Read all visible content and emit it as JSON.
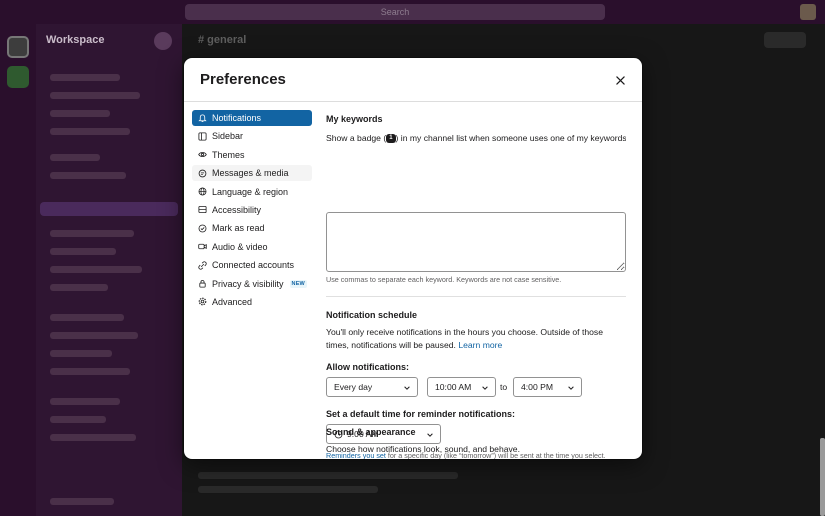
{
  "background": {
    "search_placeholder": "Search",
    "workspace_name": "Workspace",
    "channel_title": "# general"
  },
  "modal": {
    "title": "Preferences",
    "close_icon": "close-icon"
  },
  "nav": [
    {
      "label": "Notifications",
      "icon": "bell-icon",
      "active": true
    },
    {
      "label": "Sidebar",
      "icon": "sidebar-icon"
    },
    {
      "label": "Themes",
      "icon": "eye-icon"
    },
    {
      "label": "Messages & media",
      "icon": "message-icon",
      "hover": true
    },
    {
      "label": "Language & region",
      "icon": "globe-icon"
    },
    {
      "label": "Accessibility",
      "icon": "accessibility-icon"
    },
    {
      "label": "Mark as read",
      "icon": "check-circle-icon"
    },
    {
      "label": "Audio & video",
      "icon": "video-icon"
    },
    {
      "label": "Connected accounts",
      "icon": "link-icon"
    },
    {
      "label": "Privacy & visibility",
      "icon": "lock-icon",
      "badge": "NEW"
    },
    {
      "label": "Advanced",
      "icon": "gear-icon"
    }
  ],
  "keywords": {
    "heading": "My keywords",
    "desc_before": "Show a badge (",
    "badge_count": "1",
    "desc_after": ") in my channel list when someone uses one of my keywords:",
    "value": "",
    "help": "Use commas to separate each keyword. Keywords are not case sensitive."
  },
  "schedule": {
    "heading": "Notification schedule",
    "desc": "You'll only receive notifications in the hours you choose. Outside of those times, notifications will be paused.",
    "learn_more": "Learn more",
    "allow_label": "Allow notifications:",
    "day_value": "Every day",
    "from_value": "10:00 AM",
    "to_label": "to",
    "until_value": "4:00 PM"
  },
  "reminder": {
    "heading": "Set a default time for reminder notifications:",
    "time_value": "9:00 AM",
    "help_link": "Reminders you set",
    "help_rest": "for a specific day (like “tomorrow”) will be sent at the time you select."
  },
  "sound": {
    "heading": "Sound & appearance",
    "desc": "Choose how notifications look, sound, and behave."
  },
  "colors": {
    "accent": "#1264a3",
    "text": "#1d1c1d"
  }
}
